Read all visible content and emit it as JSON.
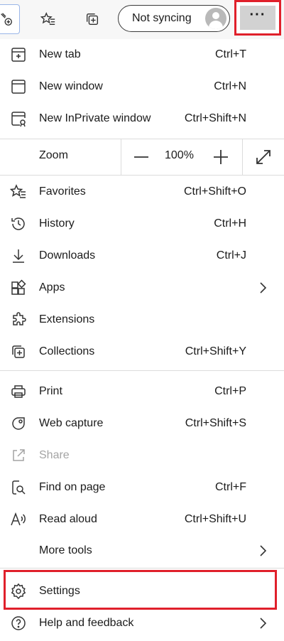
{
  "toolbar": {
    "sync_label": "Not syncing",
    "more_label": "···"
  },
  "menu": {
    "new_tab": {
      "label": "New tab",
      "shortcut": "Ctrl+T"
    },
    "new_window": {
      "label": "New window",
      "shortcut": "Ctrl+N"
    },
    "new_inprivate": {
      "label": "New InPrivate window",
      "shortcut": "Ctrl+Shift+N"
    },
    "zoom": {
      "label": "Zoom",
      "value": "100%"
    },
    "favorites": {
      "label": "Favorites",
      "shortcut": "Ctrl+Shift+O"
    },
    "history": {
      "label": "History",
      "shortcut": "Ctrl+H"
    },
    "downloads": {
      "label": "Downloads",
      "shortcut": "Ctrl+J"
    },
    "apps": {
      "label": "Apps"
    },
    "extensions": {
      "label": "Extensions"
    },
    "collections": {
      "label": "Collections",
      "shortcut": "Ctrl+Shift+Y"
    },
    "print": {
      "label": "Print",
      "shortcut": "Ctrl+P"
    },
    "web_capture": {
      "label": "Web capture",
      "shortcut": "Ctrl+Shift+S"
    },
    "share": {
      "label": "Share"
    },
    "find_on_page": {
      "label": "Find on page",
      "shortcut": "Ctrl+F"
    },
    "read_aloud": {
      "label": "Read aloud",
      "shortcut": "Ctrl+Shift+U"
    },
    "more_tools": {
      "label": "More tools"
    },
    "settings": {
      "label": "Settings"
    },
    "help_feedback": {
      "label": "Help and feedback"
    }
  },
  "colors": {
    "highlight": "#e0202b",
    "text": "#1b1b1b",
    "disabled_text": "#a4a4a4"
  },
  "icons": [
    "extension-icon",
    "favorites-icon",
    "collections-icon",
    "avatar-icon",
    "more-icon",
    "new-tab-icon",
    "new-window-icon",
    "inprivate-icon",
    "zoom-out-icon",
    "zoom-in-icon",
    "fullscreen-icon",
    "favorites-icon",
    "history-icon",
    "download-icon",
    "apps-icon",
    "extensions-icon",
    "collections-icon",
    "print-icon",
    "web-capture-icon",
    "share-icon",
    "find-icon",
    "read-aloud-icon",
    "settings-icon",
    "help-icon",
    "chevron-right-icon"
  ]
}
